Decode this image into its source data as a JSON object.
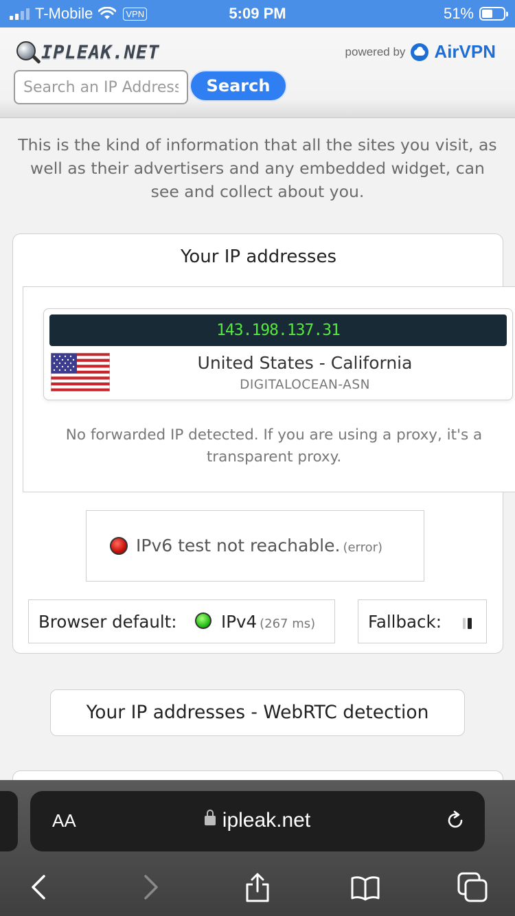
{
  "status_bar": {
    "carrier": "T-Mobile",
    "vpn": "VPN",
    "time": "5:09 PM",
    "battery": "51%",
    "battery_level": 0.51
  },
  "header": {
    "logo_text": "IPLEAK.NET",
    "powered_by": "powered by",
    "brand": "AirVPN",
    "search_placeholder": "Search an IP Address",
    "search_button": "Search"
  },
  "intro": "This is the kind of information that all the sites you visit, as well as their advertisers and any embedded widget, can see and collect about you.",
  "ip_card": {
    "title": "Your IP addresses",
    "ip": "143.198.137.31",
    "location": "United States - California",
    "asn": "DIGITALOCEAN-ASN",
    "forward_note": "No forwarded IP detected. If you are using a proxy, it's a transparent proxy.",
    "ipv6_status": "IPv6 test not reachable.",
    "ipv6_error": "(error)",
    "browser_default_label": "Browser default:",
    "browser_default_proto": "IPv4",
    "browser_default_ms": "(267 ms)",
    "fallback_label": "Fallback:"
  },
  "webrtc_button": "Your IP addresses - WebRTC detection",
  "safari": {
    "aa": "AA",
    "url": "ipleak.net"
  },
  "colors": {
    "status_bar": "#4a8fe7",
    "search_button": "#2f7ff3",
    "ip_text": "#56e83e",
    "ip_bg": "#172a35",
    "brand": "#1d6fd6"
  }
}
